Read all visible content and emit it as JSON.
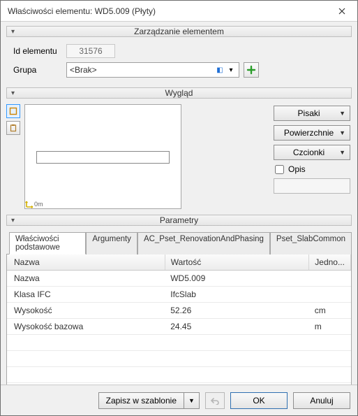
{
  "window": {
    "title": "Właściwości elementu: WD5.009 (Płyty)"
  },
  "sections": {
    "mgmt": "Zarządzanie elementem",
    "appearance": "Wygląd",
    "params": "Parametry"
  },
  "mgmt": {
    "id_label": "Id elementu",
    "id_value": "31576",
    "group_label": "Grupa",
    "group_value": "<Brak>"
  },
  "appearance": {
    "pens": "Pisaki",
    "surfaces": "Powierzchnie",
    "fonts": "Czcionki",
    "desc_label": "Opis",
    "zero_badge": "0m"
  },
  "params": {
    "tabs": [
      "Właściwości podstawowe",
      "Argumenty",
      "AC_Pset_RenovationAndPhasing",
      "Pset_SlabCommon"
    ],
    "columns": [
      "Nazwa",
      "Wartość",
      "Jedno..."
    ],
    "rows": [
      {
        "name": "Nazwa",
        "value": "WD5.009",
        "unit": ""
      },
      {
        "name": "Klasa IFC",
        "value": "IfcSlab",
        "unit": ""
      },
      {
        "name": "Wysokość",
        "value": "52.26",
        "unit": "cm"
      },
      {
        "name": "Wysokość bazowa",
        "value": "24.45",
        "unit": "m"
      }
    ]
  },
  "footer": {
    "save_tpl": "Zapisz w szablonie",
    "ok": "OK",
    "cancel": "Anuluj"
  }
}
